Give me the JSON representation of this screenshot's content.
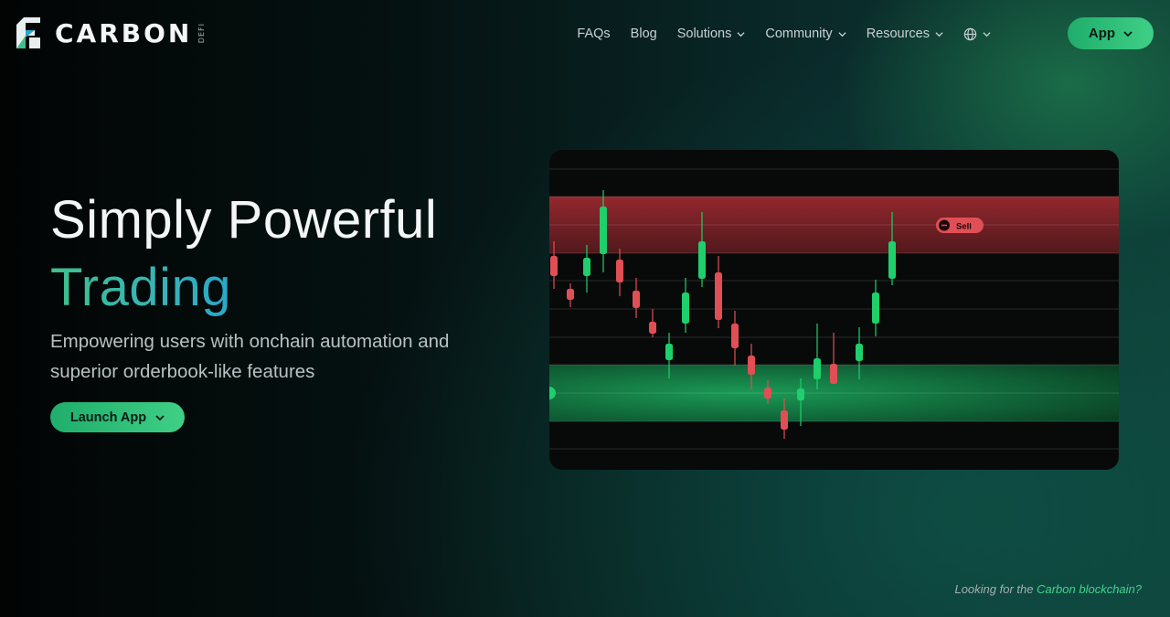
{
  "brand": {
    "name": "CARBON",
    "tag": "DEFI"
  },
  "nav": {
    "items": [
      {
        "label": "FAQs",
        "dropdown": false
      },
      {
        "label": "Blog",
        "dropdown": false
      },
      {
        "label": "Solutions",
        "dropdown": true
      },
      {
        "label": "Community",
        "dropdown": true
      },
      {
        "label": "Resources",
        "dropdown": true
      }
    ],
    "language_icon": "globe-icon",
    "app_button": "App"
  },
  "hero": {
    "title": "Simply Powerful",
    "accent": "Trading",
    "subtitle": "Empowering users with onchain automation and superior orderbook-like features",
    "cta": "Launch App"
  },
  "chart": {
    "sell_label": "Sell",
    "colors": {
      "up": "#1fcf6b",
      "down": "#e04f55",
      "sell_band": "#7a1e24",
      "buy_band": "#0e6b3a"
    }
  },
  "footer": {
    "prefix": "Looking for the ",
    "link": "Carbon blockchain?"
  },
  "colors": {
    "accent": "#3fcf86",
    "background": "#05100f"
  }
}
